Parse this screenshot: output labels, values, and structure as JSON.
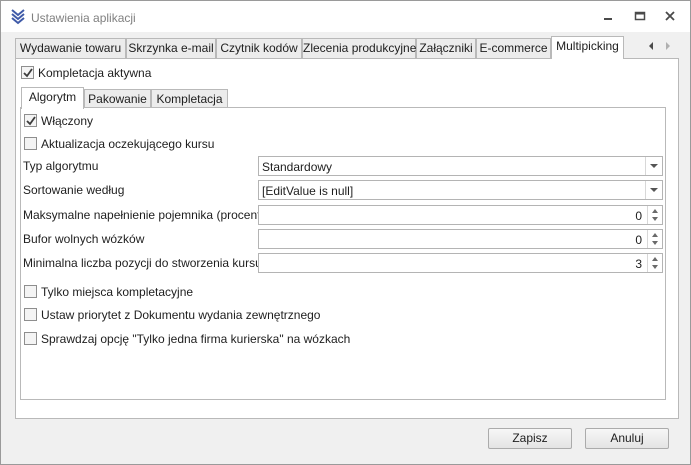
{
  "window": {
    "title": "Ustawienia aplikacji",
    "icon": "app-logo-icon"
  },
  "tabs": [
    {
      "label": "Wydawanie towaru"
    },
    {
      "label": "Skrzynka e-mail"
    },
    {
      "label": "Czytnik kodów"
    },
    {
      "label": "Zlecenia produkcyjne"
    },
    {
      "label": "Załączniki"
    },
    {
      "label": "E-commerce"
    },
    {
      "label": "Multipicking",
      "active": true
    }
  ],
  "multipicking": {
    "active_checkbox": {
      "label": "Kompletacja aktywna",
      "checked": true
    },
    "subtabs": [
      {
        "label": "Algorytm",
        "active": true
      },
      {
        "label": "Pakowanie"
      },
      {
        "label": "Kompletacja"
      }
    ],
    "algorytm": {
      "enabled": {
        "label": "Włączony",
        "checked": true
      },
      "update_waiting": {
        "label": "Aktualizacja oczekującego kursu",
        "checked": false
      },
      "algorithm_type": {
        "label": "Typ algorytmu",
        "value": "Standardowy"
      },
      "sort_by": {
        "label": "Sortowanie według",
        "value": "[EditValue is null]"
      },
      "max_fill": {
        "label": "Maksymalne napełnienie pojemnika (procent)",
        "value": "0"
      },
      "free_carts": {
        "label": "Bufor wolnych wózków",
        "value": "0"
      },
      "min_positions": {
        "label": "Minimalna liczba pozycji do stworzenia kursu",
        "value": "3"
      },
      "only_picking_places": {
        "label": "Tylko miejsca kompletacyjne",
        "checked": false
      },
      "priority_external": {
        "label": "Ustaw priorytet z Dokumentu wydania zewnętrznego",
        "checked": false
      },
      "single_courier": {
        "label": "Sprawdzaj opcję \"Tylko jedna firma kurierska\" na wózkach",
        "checked": false
      }
    }
  },
  "buttons": {
    "save": "Zapisz",
    "cancel": "Anuluj"
  },
  "colors": {
    "accent": "#3f5aa8",
    "border": "#b9b9b9",
    "check": "#3c3c3c"
  }
}
